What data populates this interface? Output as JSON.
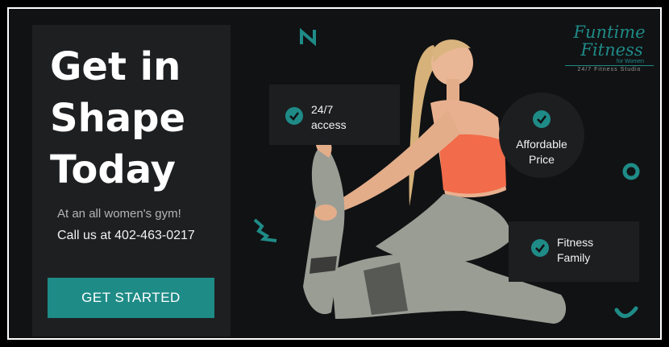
{
  "headline": {
    "line1": "Get in",
    "line2": "Shape",
    "line3": "Today"
  },
  "tagline": "At an all women's gym!",
  "phone_text": "Call us at 402-463-0217",
  "cta_label": "GET STARTED",
  "features": [
    {
      "line1": "24/7",
      "line2": "access"
    },
    {
      "line1": "Affordable",
      "line2": "Price"
    },
    {
      "line1": "Fitness",
      "line2": "Family"
    }
  ],
  "logo": {
    "line1": "Funtime",
    "line2": "Fitness",
    "line3": "for Women",
    "line4": "24/7 Fitness Studio"
  },
  "colors": {
    "accent": "#1f8b87",
    "background": "#111214",
    "panel": "#1e1f21",
    "top": "#f26b4a",
    "leggings": "#9a9d94"
  },
  "icons": [
    "check-icon",
    "zigzag-deco-icon",
    "ring-deco-icon",
    "arc-deco-icon"
  ]
}
